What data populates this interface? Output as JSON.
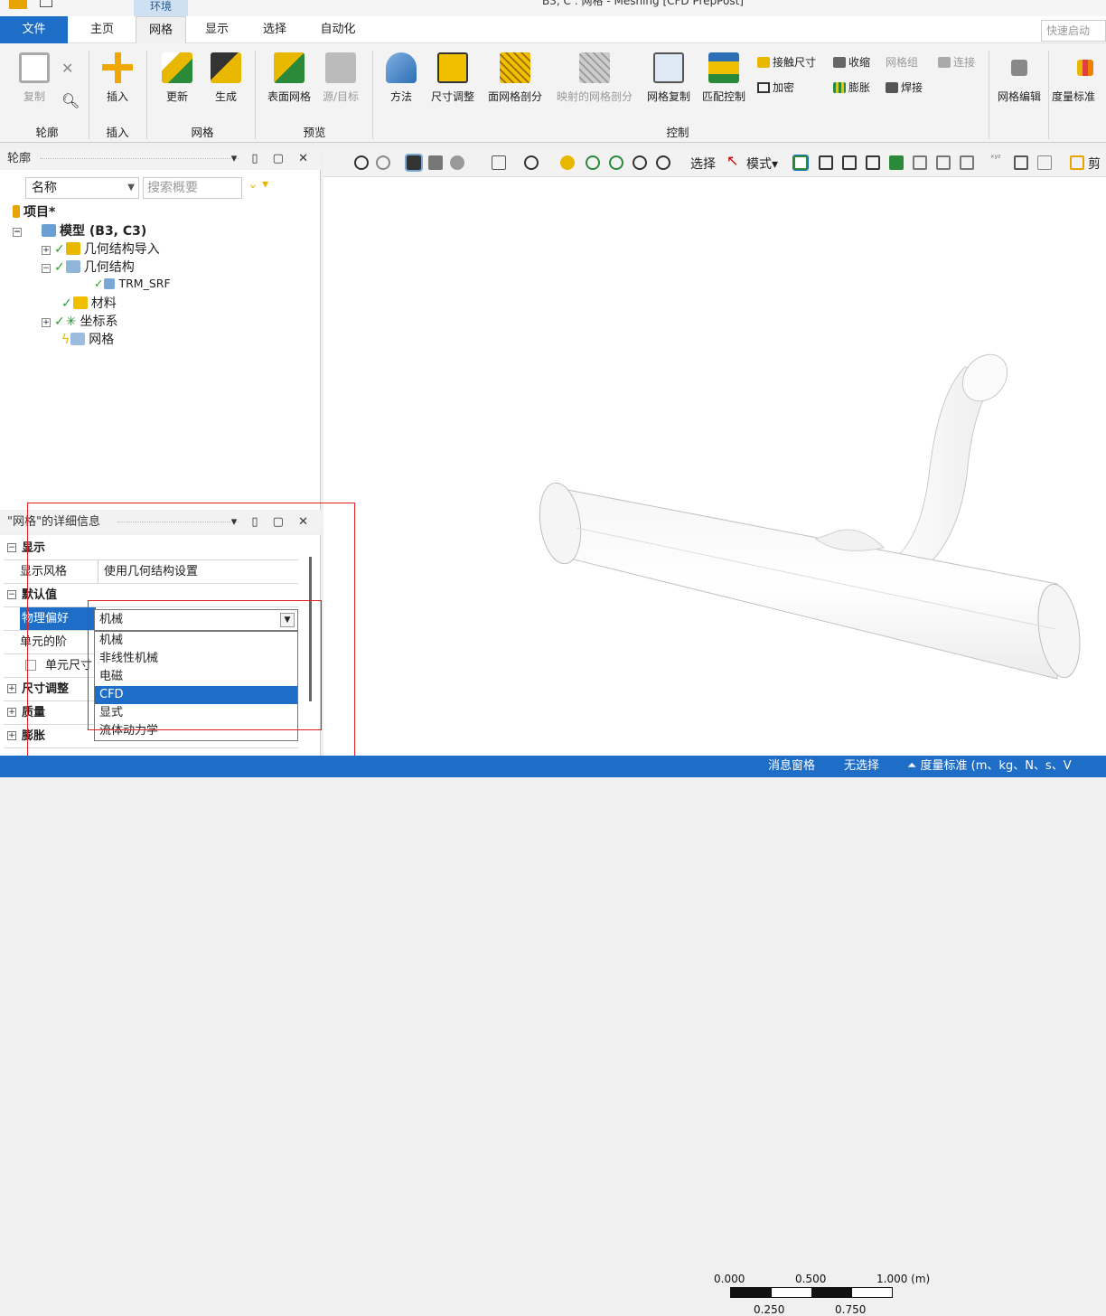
{
  "window": {
    "title": "B3, C : 网格 - Meshing [CFD PrepPost]",
    "context_tab": "环境"
  },
  "tabs": [
    "文件",
    "主页",
    "网格",
    "显示",
    "选择",
    "自动化"
  ],
  "active_tab": "网格",
  "quick_launch": {
    "placeholder": "快速启动"
  },
  "ribbon": {
    "outline_group": {
      "label": "轮廓",
      "copy": "复制"
    },
    "insert_group": {
      "label": "插入",
      "insert": "插入"
    },
    "mesh_group": {
      "label": "网格",
      "update": "更新",
      "generate": "生成"
    },
    "preview_group": {
      "label": "预览",
      "surface_mesh": "表面网格",
      "source_target": "源/目标"
    },
    "control_group": {
      "label": "控制",
      "method": "方法",
      "sizing": "尺寸调整",
      "face_meshing": "面网格剖分",
      "mapped_face": "映射的网格剖分",
      "mesh_copy": "网格复制",
      "match_control": "匹配控制",
      "contact_sizing": "接触尺寸",
      "refinement": "加密",
      "pinch": "收缩",
      "mesh_group_btn": "网格组",
      "connect": "连接",
      "inflation": "膨胀",
      "weld": "焊接"
    },
    "mesh_edit": "网格编辑",
    "metric": "度量标准"
  },
  "outline": {
    "title": "轮廓",
    "name_col": "名称",
    "search_placeholder": "搜索概要",
    "tree": {
      "project": "项目*",
      "model": "模型 (B3, C3)",
      "geometry_import": "几何结构导入",
      "geometry": "几何结构",
      "part": "TRM_SRF",
      "materials": "材料",
      "coords": "坐标系",
      "mesh": "网格"
    }
  },
  "viewport_toolbar": {
    "select": "选择",
    "mode": "模式",
    "last": "剪"
  },
  "details": {
    "title": "\"网格\"的详细信息",
    "sections": {
      "display": "显示",
      "defaults": "默认值",
      "sizing": "尺寸调整",
      "quality": "质量",
      "inflation": "膨胀"
    },
    "rows": {
      "display_style_key": "显示风格",
      "display_style_val": "使用几何结构设置",
      "physics_key": "物理偏好",
      "physics_val": "机械",
      "element_order_key": "单元的阶",
      "element_size_key": "单元尺寸"
    },
    "options": [
      "机械",
      "非线性机械",
      "电磁",
      "CFD",
      "显式",
      "流体动力学"
    ],
    "selected_option": "CFD"
  },
  "scale": {
    "t0": "0.000",
    "t1": "0.500",
    "t2": "1.000 (m)",
    "b1": "0.250",
    "b2": "0.750"
  },
  "status": {
    "messages": "消息窗格",
    "selection": "无选择",
    "units": "度量标准 (m、kg、N、s、V"
  },
  "colors": {
    "accent": "#1e6ec8",
    "highlight": "#e02020"
  }
}
